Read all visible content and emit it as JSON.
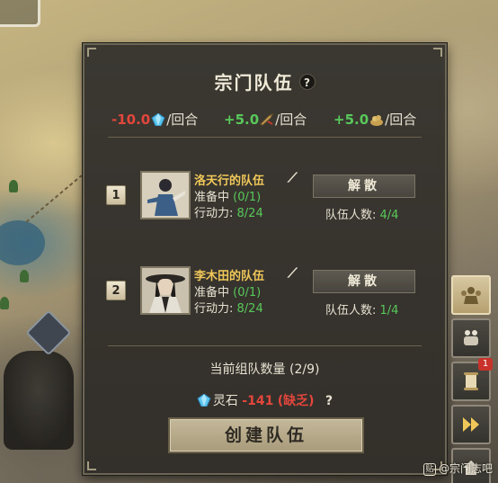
{
  "panel": {
    "title": "宗门队伍",
    "help": "?",
    "rates": [
      {
        "value": "-10.0",
        "unit": "/回合",
        "icon": "spirit-stone-icon",
        "tone": "neg"
      },
      {
        "value": "+5.0",
        "unit": "/回合",
        "icon": "action-icon",
        "tone": "pos"
      },
      {
        "value": "+5.0",
        "unit": "/回合",
        "icon": "food-icon",
        "tone": "pos"
      }
    ],
    "teams": [
      {
        "index": "1",
        "name": "洛天行的队伍",
        "status_label": "准备中",
        "status_value": "(0/1)",
        "ap_label": "行动力:",
        "ap_value": "8/24",
        "disband_label": "解散",
        "count_label": "队伍人数:",
        "count_value": "4/4"
      },
      {
        "index": "2",
        "name": "李木田的队伍",
        "status_label": "准备中",
        "status_value": "(0/1)",
        "ap_label": "行动力:",
        "ap_value": "8/24",
        "disband_label": "解散",
        "count_label": "队伍人数:",
        "count_value": "1/4"
      }
    ],
    "team_total": "当前组队数量 (2/9)",
    "cost": {
      "label": "灵石",
      "amount": "-141",
      "status": "(缺乏)",
      "help": "?"
    },
    "create_label": "创建队伍"
  },
  "side": {
    "badge_count": "1"
  },
  "watermark": {
    "icon_text": "贴",
    "text": "@宗门志吧"
  },
  "colors": {
    "negative": "#e2463c",
    "positive": "#58c85a",
    "team_name": "#f0c85a"
  }
}
